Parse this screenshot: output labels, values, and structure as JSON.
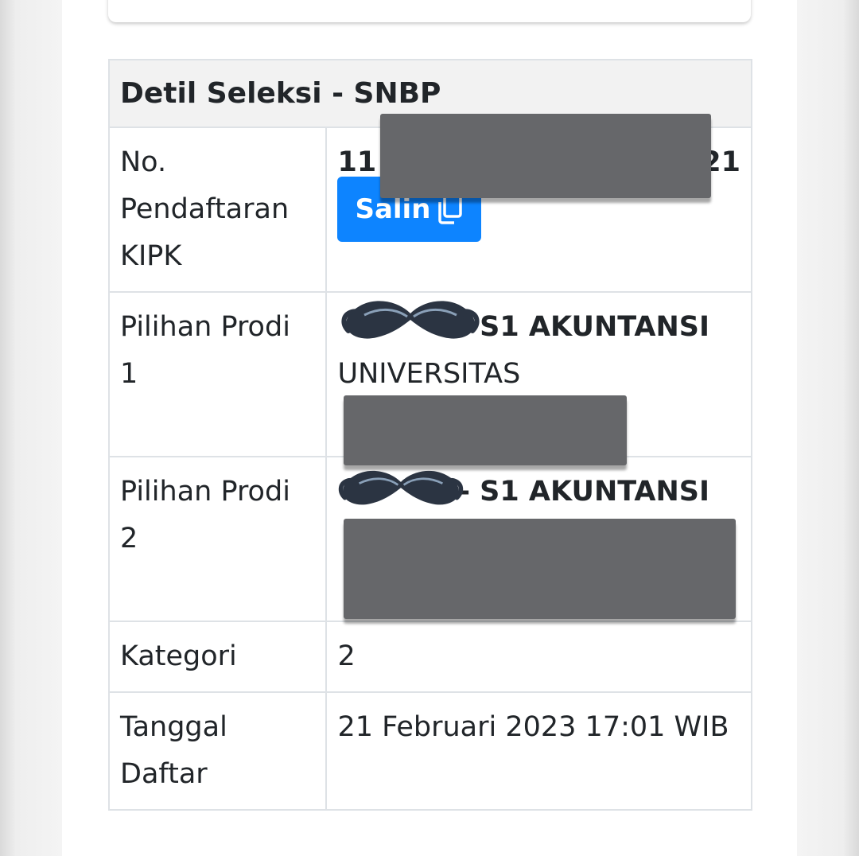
{
  "table": {
    "title": "Detil Seleksi - SNBP",
    "rows": [
      {
        "label": "No. Pendaftaran KIPK",
        "value_start": "11",
        "value_end": "21",
        "copy_label": "Salin"
      },
      {
        "label": "Pilihan Prodi 1",
        "program": "- S1 AKUNTANSI",
        "university": "UNIVERSITAS"
      },
      {
        "label": "Pilihan Prodi 2",
        "program": "- S1 AKUNTANSI"
      },
      {
        "label": "Kategori",
        "value": "2"
      },
      {
        "label": "Tanggal Daftar",
        "value": "21 Februari 2023 17:01 WIB"
      }
    ]
  },
  "colors": {
    "button": "#0d84ff",
    "header_bg": "#f2f2f2",
    "border": "#dee2e6",
    "redaction": "#66676a"
  },
  "icons": [
    "copy-icon",
    "mustache-sticker"
  ]
}
